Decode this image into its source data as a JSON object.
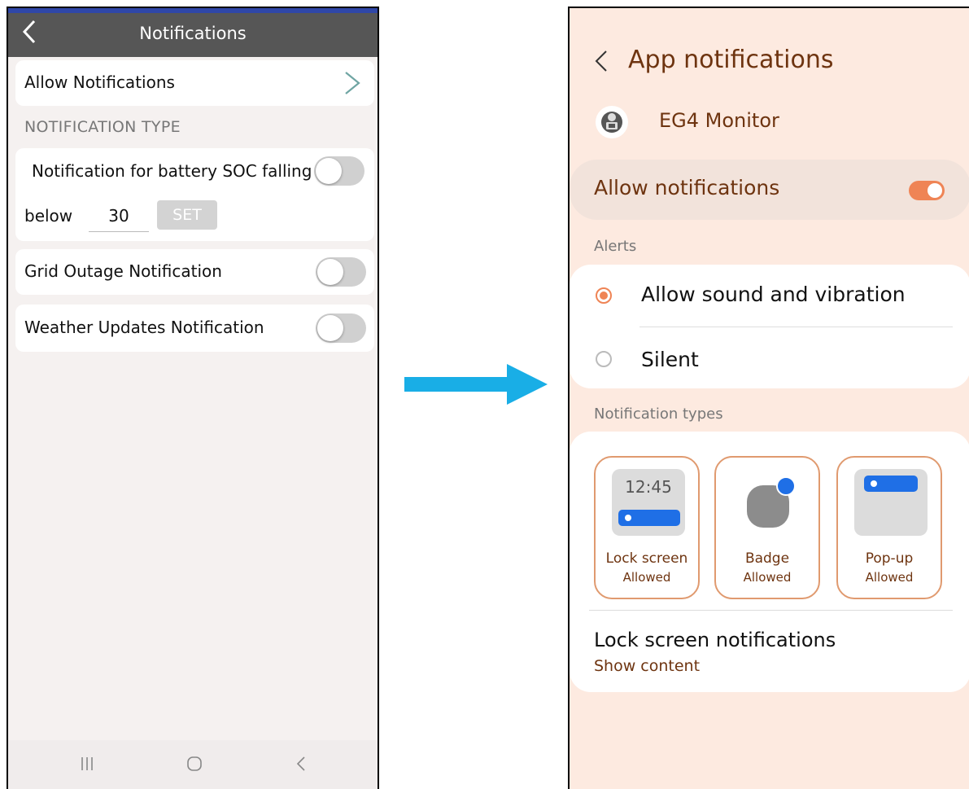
{
  "left": {
    "header": {
      "title": "Notifications"
    },
    "allow_row": {
      "label": "Allow Notifications"
    },
    "section_header": "NOTIFICATION TYPE",
    "soc": {
      "label_line1": "Notification for battery SOC falling",
      "label_below": "below",
      "value": "30",
      "set_label": "SET"
    },
    "grid_outage": {
      "label": "Grid Outage Notification"
    },
    "weather": {
      "label": "Weather Updates Notification"
    }
  },
  "right": {
    "header": {
      "title": "App notifications"
    },
    "app": {
      "name": "EG4 Monitor"
    },
    "allow": {
      "label": "Allow notifications",
      "on": true
    },
    "alerts": {
      "header": "Alerts",
      "options": [
        {
          "label": "Allow sound and vibration",
          "selected": true
        },
        {
          "label": "Silent",
          "selected": false
        }
      ]
    },
    "notification_types": {
      "header": "Notification types",
      "items": [
        {
          "label": "Lock screen",
          "status": "Allowed",
          "preview_time": "12:45"
        },
        {
          "label": "Badge",
          "status": "Allowed"
        },
        {
          "label": "Pop-up",
          "status": "Allowed"
        }
      ]
    },
    "lock_screen_notifications": {
      "title": "Lock screen notifications",
      "value": "Show content"
    }
  },
  "colors": {
    "accent_orange": "#ef8455",
    "brown_text": "#6e3410",
    "arrow_blue": "#19aee6",
    "badge_blue": "#1f6fe6"
  }
}
